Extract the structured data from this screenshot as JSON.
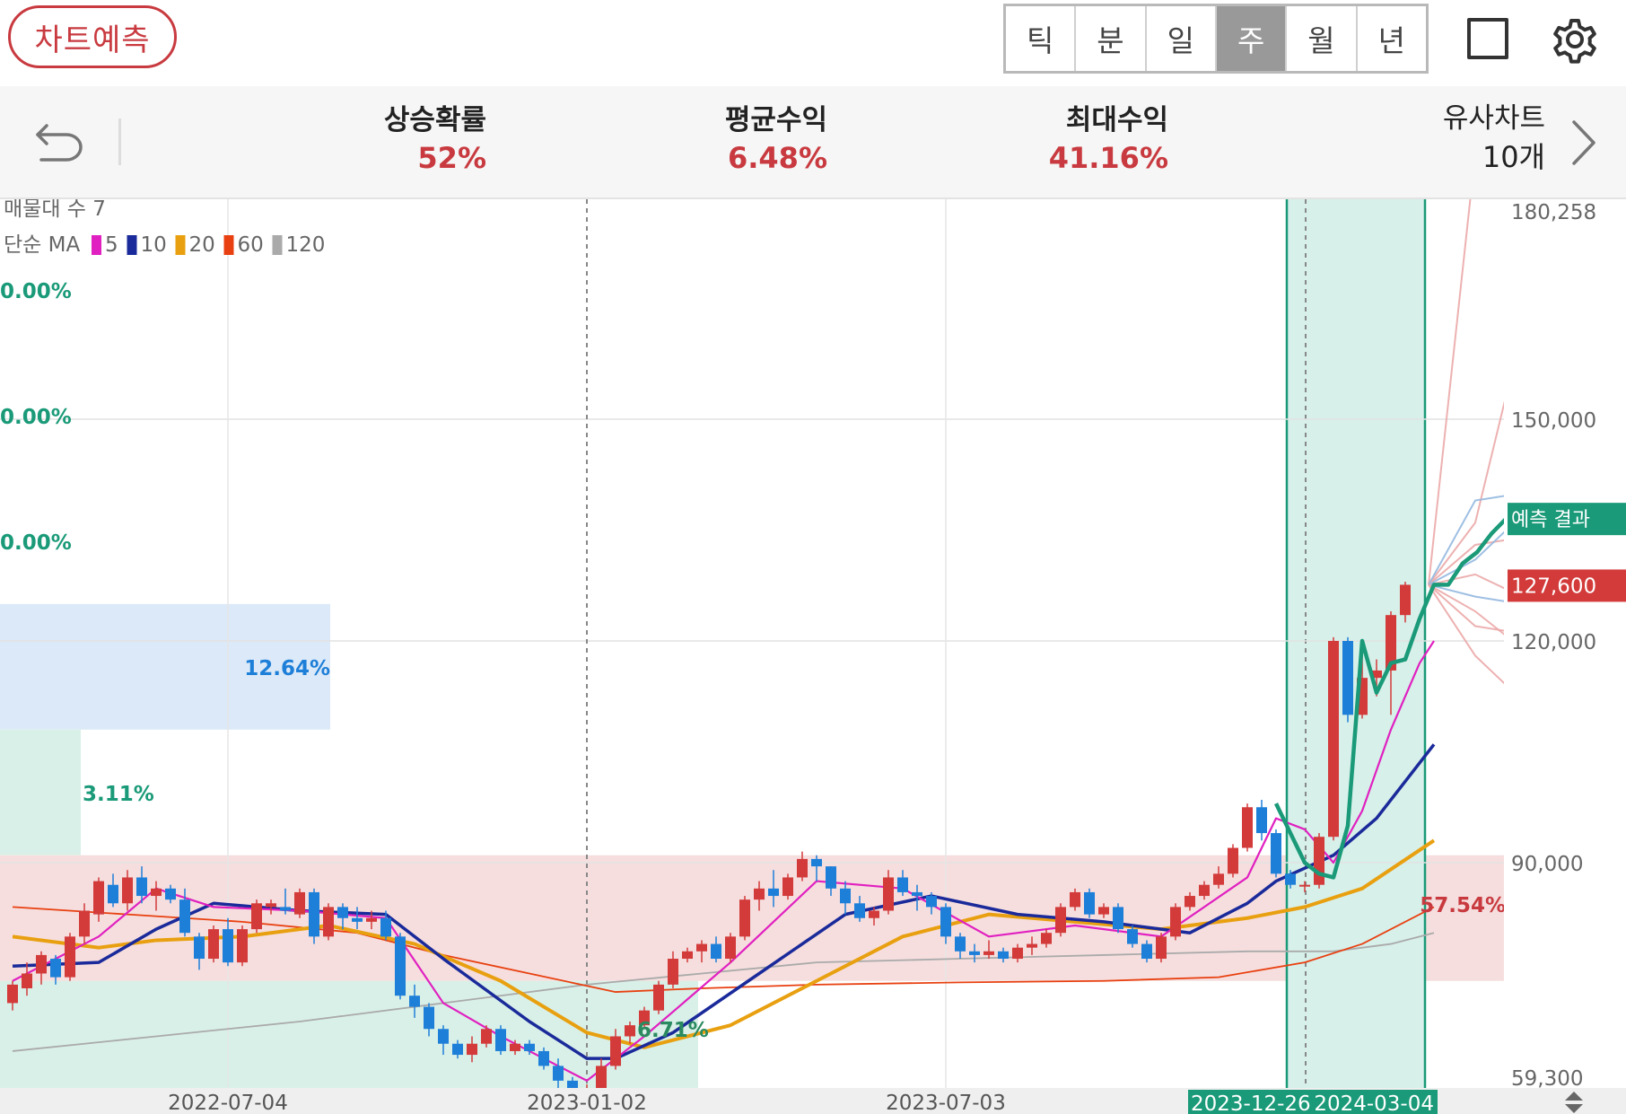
{
  "header": {
    "predict_button": "차트예측",
    "period_tabs": [
      "틱",
      "분",
      "일",
      "주",
      "월",
      "년"
    ],
    "active_period": "주"
  },
  "stats": {
    "rise_prob_label": "상승확률",
    "rise_prob_value": "52%",
    "avg_return_label": "평균수익",
    "avg_return_value": "6.48%",
    "max_return_label": "최대수익",
    "max_return_value": "41.16%",
    "similar_label": "유사차트",
    "similar_value": "10개"
  },
  "icons": [
    "undo-icon",
    "square-icon",
    "gear-icon",
    "chevron-right-icon",
    "scroll-arrows-icon"
  ],
  "colors": {
    "accent_red": "#c83a3f",
    "up": "#d33a3a",
    "down": "#1e7fd8",
    "prediction": "#1a9a78",
    "ma5": "#e020c0",
    "ma10": "#1a2a9a",
    "ma20": "#e8a010",
    "ma60": "#e84010",
    "ma120": "#aaaaaa"
  },
  "chart_data": {
    "type": "candlestick",
    "overlay_labels": {
      "volume_profile": "매물대 수 7",
      "ma_title": "단순 MA"
    },
    "ma_legend": [
      {
        "period": "5",
        "color": "#e020c0"
      },
      {
        "period": "10",
        "color": "#1a2a9a"
      },
      {
        "period": "20",
        "color": "#e8a010"
      },
      {
        "period": "60",
        "color": "#e84010"
      },
      {
        "period": "120",
        "color": "#aaaaaa"
      }
    ],
    "y_ticks": [
      "180,258",
      "150,000",
      "120,000",
      "90,000",
      "59,300"
    ],
    "y_tick_values": [
      180258,
      150000,
      120000,
      90000,
      59300
    ],
    "x_ticks": [
      "2022-07-04",
      "2023-01-02",
      "2023-07-03"
    ],
    "highlight_range": {
      "start": "2023-12-26",
      "end": "2024-03-04"
    },
    "current_price_label": "127,600",
    "current_price": 127600,
    "prediction_label": "예측 결과",
    "volume_zones": [
      {
        "label": "0.00%",
        "low": 159000,
        "high": 176000
      },
      {
        "label": "0.00%",
        "low": 142000,
        "high": 159000
      },
      {
        "label": "0.00%",
        "low": 125000,
        "high": 142000
      },
      {
        "label": "12.64%",
        "low": 108000,
        "high": 125000
      },
      {
        "label": "3.11%",
        "low": 91000,
        "high": 108000
      },
      {
        "label": "57.54%",
        "low": 74000,
        "high": 91000
      },
      {
        "label": "6.71%",
        "low": 57000,
        "high": 74000
      }
    ],
    "candles": [
      [
        71000,
        74000,
        70000,
        73500
      ],
      [
        73000,
        76500,
        72000,
        75000
      ],
      [
        75000,
        78000,
        73500,
        77500
      ],
      [
        77000,
        77500,
        73500,
        74500
      ],
      [
        74500,
        80500,
        74000,
        80000
      ],
      [
        80000,
        84500,
        79000,
        83500
      ],
      [
        83000,
        88000,
        82000,
        87500
      ],
      [
        87000,
        88500,
        84000,
        84500
      ],
      [
        84500,
        89000,
        83500,
        88000
      ],
      [
        88000,
        89500,
        84500,
        85500
      ],
      [
        85500,
        87500,
        83500,
        86500
      ],
      [
        86500,
        87000,
        84500,
        85000
      ],
      [
        85000,
        86500,
        80000,
        80500
      ],
      [
        80000,
        80500,
        75500,
        77000
      ],
      [
        77000,
        81500,
        76500,
        81000
      ],
      [
        81000,
        82500,
        76000,
        76500
      ],
      [
        76500,
        81500,
        76000,
        81000
      ],
      [
        81000,
        85000,
        80500,
        84500
      ],
      [
        84000,
        85000,
        83000,
        84500
      ],
      [
        84000,
        86500,
        83000,
        83500
      ],
      [
        83000,
        86500,
        82500,
        86000
      ],
      [
        86000,
        86500,
        79000,
        80000
      ],
      [
        80000,
        84500,
        79500,
        84000
      ],
      [
        84000,
        84500,
        81000,
        82500
      ],
      [
        82500,
        84000,
        81000,
        82000
      ],
      [
        82000,
        83500,
        81000,
        82500
      ],
      [
        82500,
        83500,
        79500,
        80000
      ],
      [
        80000,
        80500,
        71500,
        72000
      ],
      [
        72000,
        73500,
        69000,
        70500
      ],
      [
        70500,
        71000,
        66500,
        67500
      ],
      [
        67500,
        68000,
        64000,
        65500
      ],
      [
        65500,
        66000,
        63500,
        64000
      ],
      [
        64000,
        66500,
        63000,
        65500
      ],
      [
        65500,
        68000,
        65000,
        67500
      ],
      [
        67500,
        68000,
        64000,
        64500
      ],
      [
        64500,
        66000,
        64000,
        65500
      ],
      [
        65500,
        66000,
        64000,
        64500
      ],
      [
        64500,
        65000,
        62000,
        62500
      ],
      [
        62500,
        63500,
        59500,
        60500
      ],
      [
        60500,
        61000,
        57500,
        58500
      ],
      [
        58500,
        60000,
        58000,
        59500
      ],
      [
        59500,
        63500,
        59000,
        62500
      ],
      [
        62500,
        67500,
        62000,
        66500
      ],
      [
        66500,
        68500,
        65500,
        68000
      ],
      [
        68000,
        70500,
        67500,
        70000
      ],
      [
        70000,
        74000,
        69500,
        73500
      ],
      [
        73500,
        78000,
        73000,
        77000
      ],
      [
        77000,
        78500,
        76500,
        78000
      ],
      [
        78000,
        79500,
        76500,
        79000
      ],
      [
        79000,
        80000,
        76500,
        77000
      ],
      [
        77000,
        80500,
        76500,
        80000
      ],
      [
        80000,
        85500,
        79500,
        85000
      ],
      [
        85000,
        87500,
        83500,
        86500
      ],
      [
        86500,
        89000,
        84000,
        85500
      ],
      [
        85500,
        88500,
        85000,
        88000
      ],
      [
        88000,
        91500,
        87500,
        90500
      ],
      [
        90500,
        91000,
        87500,
        89500
      ],
      [
        89500,
        89500,
        85500,
        86500
      ],
      [
        86500,
        87500,
        83000,
        84500
      ],
      [
        84500,
        85500,
        82000,
        82500
      ],
      [
        82500,
        84000,
        81500,
        83500
      ],
      [
        83500,
        89000,
        83000,
        88000
      ],
      [
        88000,
        89000,
        85500,
        86000
      ],
      [
        86000,
        87000,
        83500,
        85500
      ],
      [
        85500,
        86000,
        83000,
        84000
      ],
      [
        84000,
        84500,
        79000,
        80000
      ],
      [
        80000,
        80500,
        77000,
        78000
      ],
      [
        78000,
        79000,
        76500,
        77500
      ],
      [
        77500,
        79500,
        77000,
        78000
      ],
      [
        78000,
        78500,
        76500,
        77000
      ],
      [
        77000,
        79000,
        76500,
        78500
      ],
      [
        78500,
        80000,
        77500,
        79000
      ],
      [
        79000,
        81000,
        78500,
        80500
      ],
      [
        80500,
        84500,
        80000,
        84000
      ],
      [
        84000,
        86500,
        83500,
        86000
      ],
      [
        86000,
        86500,
        82500,
        83000
      ],
      [
        83000,
        84500,
        82500,
        84000
      ],
      [
        84000,
        84500,
        80500,
        81000
      ],
      [
        81000,
        81500,
        78500,
        79000
      ],
      [
        79000,
        79500,
        76500,
        77000
      ],
      [
        77000,
        80500,
        76500,
        80000
      ],
      [
        80000,
        84500,
        79500,
        84000
      ],
      [
        84000,
        86000,
        83500,
        85500
      ],
      [
        85500,
        87500,
        85000,
        87000
      ],
      [
        87000,
        89500,
        86500,
        88500
      ],
      [
        88500,
        92500,
        88000,
        92000
      ],
      [
        92000,
        98000,
        91500,
        97500
      ],
      [
        97500,
        98500,
        93000,
        94000
      ],
      [
        94000,
        94500,
        88000,
        88500
      ],
      [
        88500,
        89000,
        86500,
        87000
      ],
      [
        87000,
        87500,
        86000,
        87000
      ],
      [
        87000,
        94000,
        86500,
        93500
      ],
      [
        93500,
        120500,
        93000,
        120000
      ],
      [
        120000,
        120500,
        109000,
        110000
      ],
      [
        110000,
        119000,
        109500,
        115000
      ],
      [
        115000,
        117500,
        112500,
        116000
      ],
      [
        116000,
        124000,
        110000,
        123500
      ],
      [
        123500,
        128000,
        122500,
        127600
      ]
    ],
    "ma_lines": {
      "ma5": [
        [
          0,
          74000
        ],
        [
          6,
          80000
        ],
        [
          10,
          86500
        ],
        [
          14,
          84000
        ],
        [
          20,
          83500
        ],
        [
          26,
          82500
        ],
        [
          30,
          71000
        ],
        [
          34,
          66500
        ],
        [
          38,
          62500
        ],
        [
          40,
          60500
        ],
        [
          44,
          66500
        ],
        [
          50,
          76500
        ],
        [
          56,
          87500
        ],
        [
          62,
          86500
        ],
        [
          68,
          80000
        ],
        [
          74,
          81500
        ],
        [
          80,
          80000
        ],
        [
          86,
          88000
        ],
        [
          88,
          96000
        ],
        [
          90,
          94500
        ],
        [
          92,
          90000
        ],
        [
          94,
          97000
        ],
        [
          96,
          108000
        ],
        [
          98,
          117000
        ],
        [
          99,
          120000
        ]
      ],
      "ma10": [
        [
          0,
          76000
        ],
        [
          6,
          76500
        ],
        [
          10,
          81000
        ],
        [
          14,
          84500
        ],
        [
          20,
          83500
        ],
        [
          26,
          83000
        ],
        [
          30,
          77000
        ],
        [
          36,
          68500
        ],
        [
          40,
          63500
        ],
        [
          42,
          63500
        ],
        [
          46,
          67000
        ],
        [
          52,
          75000
        ],
        [
          58,
          83000
        ],
        [
          64,
          85500
        ],
        [
          70,
          83000
        ],
        [
          76,
          82000
        ],
        [
          82,
          80500
        ],
        [
          86,
          84500
        ],
        [
          88,
          87500
        ],
        [
          92,
          91000
        ],
        [
          95,
          96000
        ],
        [
          99,
          106000
        ]
      ],
      "ma20": [
        [
          0,
          80000
        ],
        [
          6,
          78500
        ],
        [
          10,
          79500
        ],
        [
          16,
          80000
        ],
        [
          22,
          81500
        ],
        [
          28,
          79000
        ],
        [
          34,
          74000
        ],
        [
          40,
          67000
        ],
        [
          44,
          65000
        ],
        [
          50,
          68000
        ],
        [
          56,
          74000
        ],
        [
          62,
          80000
        ],
        [
          68,
          83000
        ],
        [
          74,
          82000
        ],
        [
          80,
          81000
        ],
        [
          86,
          82500
        ],
        [
          90,
          84000
        ],
        [
          94,
          86500
        ],
        [
          99,
          93000
        ]
      ],
      "ma60": [
        [
          0,
          84000
        ],
        [
          8,
          83000
        ],
        [
          16,
          82000
        ],
        [
          24,
          80500
        ],
        [
          30,
          77500
        ],
        [
          36,
          75000
        ],
        [
          42,
          72500
        ],
        [
          48,
          73000
        ],
        [
          56,
          73500
        ],
        [
          66,
          73800
        ],
        [
          76,
          74000
        ],
        [
          84,
          74500
        ],
        [
          90,
          76500
        ],
        [
          94,
          79000
        ],
        [
          99,
          84000
        ]
      ],
      "ma120": [
        [
          0,
          64500
        ],
        [
          10,
          66500
        ],
        [
          20,
          68500
        ],
        [
          30,
          71000
        ],
        [
          40,
          73500
        ],
        [
          48,
          75000
        ],
        [
          56,
          76500
        ],
        [
          66,
          77000
        ],
        [
          76,
          77500
        ],
        [
          86,
          78000
        ],
        [
          92,
          78000
        ],
        [
          96,
          79000
        ],
        [
          99,
          80500
        ]
      ]
    },
    "prediction_line": [
      [
        88,
        98000
      ],
      [
        89,
        94000
      ],
      [
        90,
        90000
      ],
      [
        91,
        88500
      ],
      [
        92,
        88000
      ],
      [
        93,
        95000
      ],
      [
        94,
        120000
      ],
      [
        95,
        113000
      ],
      [
        96,
        117000
      ],
      [
        97,
        117500
      ],
      [
        98,
        123000
      ],
      [
        99,
        127600
      ],
      [
        100,
        127600
      ],
      [
        101,
        130500
      ],
      [
        102,
        132000
      ],
      [
        103,
        134500
      ],
      [
        104,
        136500
      ]
    ],
    "similar_paths": [
      [
        127600,
        186000,
        184000
      ],
      [
        127600,
        136000,
        162000
      ],
      [
        127600,
        139000,
        140000
      ],
      [
        127600,
        133000,
        134000
      ],
      [
        127600,
        129000,
        126000
      ],
      [
        127600,
        126000,
        125000
      ],
      [
        127600,
        122000,
        121000
      ],
      [
        127600,
        118000,
        112000
      ],
      [
        127600,
        131000,
        137000
      ],
      [
        127600,
        124000,
        119000
      ]
    ],
    "ylim": [
      59300,
      180258
    ]
  }
}
